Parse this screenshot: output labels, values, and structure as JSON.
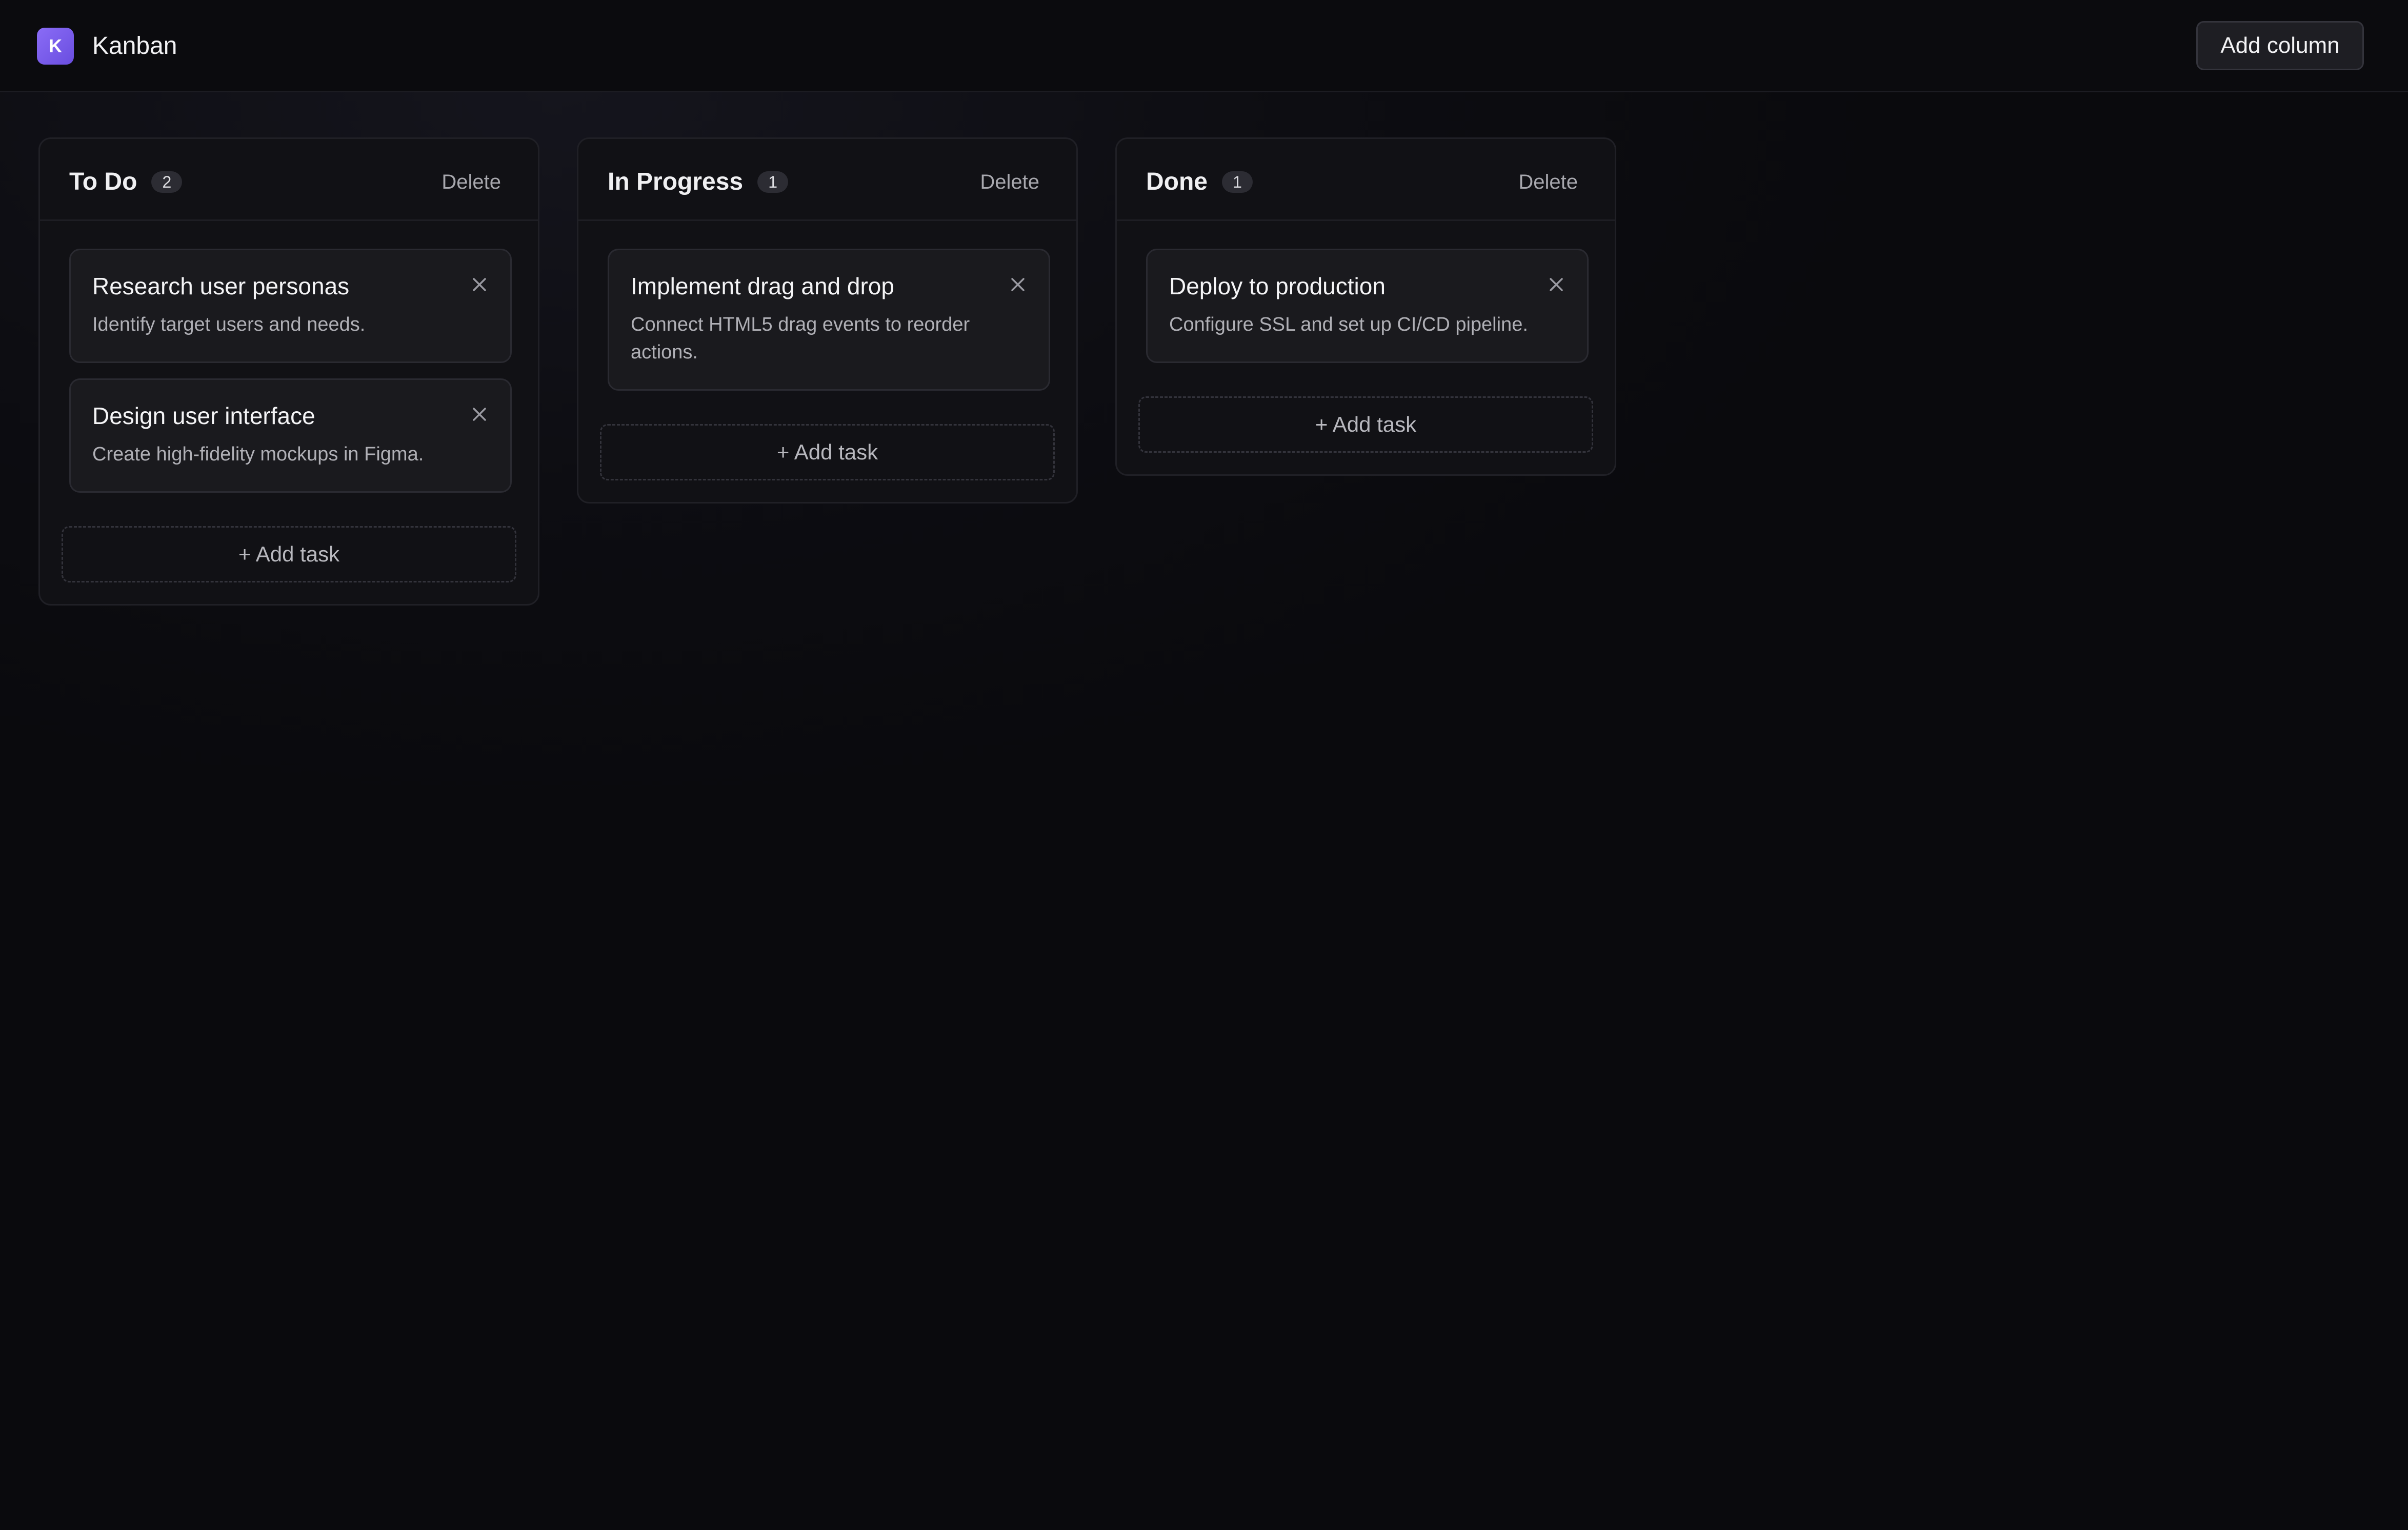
{
  "app": {
    "logo_letter": "K",
    "title": "Kanban",
    "add_column_label": "Add column",
    "accent_color": "#7c5cf0"
  },
  "columns": [
    {
      "title": "To Do",
      "count": "2",
      "delete_label": "Delete",
      "add_task_label": "+ Add task",
      "cards": [
        {
          "title": "Research user personas",
          "description": "Identify target users and needs."
        },
        {
          "title": "Design user interface",
          "description": "Create high-fidelity mockups in Figma."
        }
      ]
    },
    {
      "title": "In Progress",
      "count": "1",
      "delete_label": "Delete",
      "add_task_label": "+ Add task",
      "cards": [
        {
          "title": "Implement drag and drop",
          "description": "Connect HTML5 drag events to reorder actions."
        }
      ]
    },
    {
      "title": "Done",
      "count": "1",
      "delete_label": "Delete",
      "add_task_label": "+ Add task",
      "cards": [
        {
          "title": "Deploy to production",
          "description": "Configure SSL and set up CI/CD pipeline."
        }
      ]
    }
  ]
}
